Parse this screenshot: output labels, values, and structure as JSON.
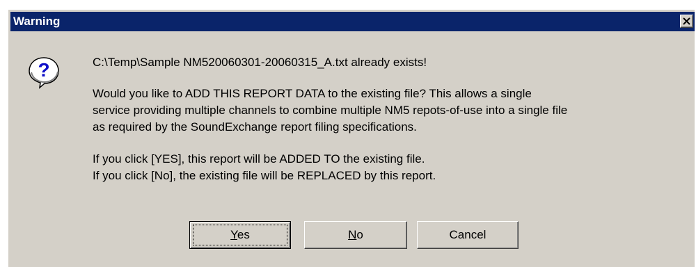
{
  "window": {
    "title": "Warning",
    "close_glyph": "✕"
  },
  "icon": "question-icon",
  "message": {
    "line1": "C:\\Temp\\Sample NM520060301-20060315_A.txt already exists!",
    "line2": "Would you like to ADD THIS REPORT DATA to the existing file? This allows a single",
    "line3": "service providing multiple channels to combine multiple NM5 repots-of-use into a single file",
    "line4": "as required by the SoundExchange report filing specifications.",
    "line5": "If you click [YES], this report will be ADDED TO the existing file.",
    "line6": "If you click [No], the existing file will be REPLACED by this report."
  },
  "buttons": {
    "yes": {
      "label": "Yes",
      "mnemonic": "Y"
    },
    "no": {
      "label": "No",
      "mnemonic": "N"
    },
    "cancel": {
      "label": "Cancel"
    }
  },
  "colors": {
    "titlebar": "#0a246a",
    "face": "#d4d0c8",
    "icon_balloon": "#ffffff",
    "icon_mark": "#1010c8"
  }
}
